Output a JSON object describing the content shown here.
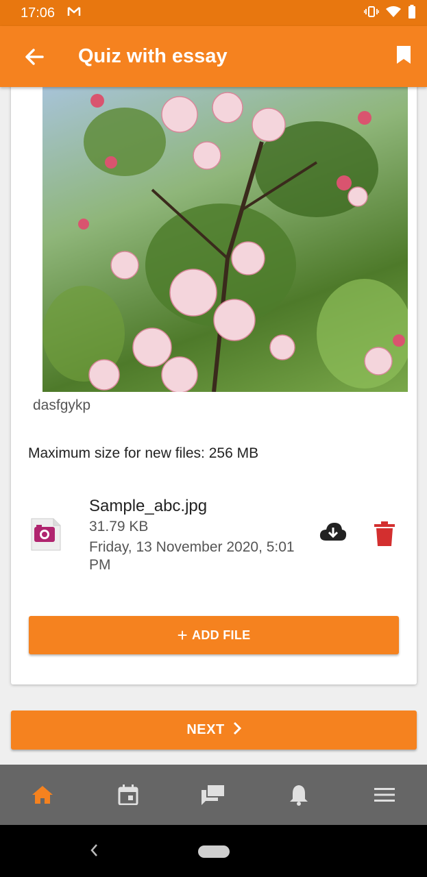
{
  "status_bar": {
    "time": "17:06",
    "notification_icon": "gmail-icon"
  },
  "app_bar": {
    "title": "Quiz with essay",
    "back_icon": "arrow-back-icon",
    "bookmark_icon": "bookmark-icon",
    "color": "#f5821f"
  },
  "question": {
    "image_description_icon": "flower-photo",
    "caption": "dasfgykp",
    "max_size_text": "Maximum size for new files: 256 MB"
  },
  "file": {
    "name": "Sample_abc.jpg",
    "size": "31.79 KB",
    "date": "Friday, 13 November 2020, 5:01 PM",
    "download_icon": "cloud-download-icon",
    "delete_icon": "trash-icon",
    "delete_color": "#d32f2f"
  },
  "buttons": {
    "add_file_label": "ADD FILE",
    "next_label": "NEXT"
  },
  "bottom_nav": {
    "items": [
      {
        "icon": "home-icon",
        "active": true
      },
      {
        "icon": "calendar-icon",
        "active": false
      },
      {
        "icon": "messages-icon",
        "active": false
      },
      {
        "icon": "bell-icon",
        "active": false
      },
      {
        "icon": "menu-icon",
        "active": false
      }
    ],
    "active_color": "#f5821f"
  }
}
